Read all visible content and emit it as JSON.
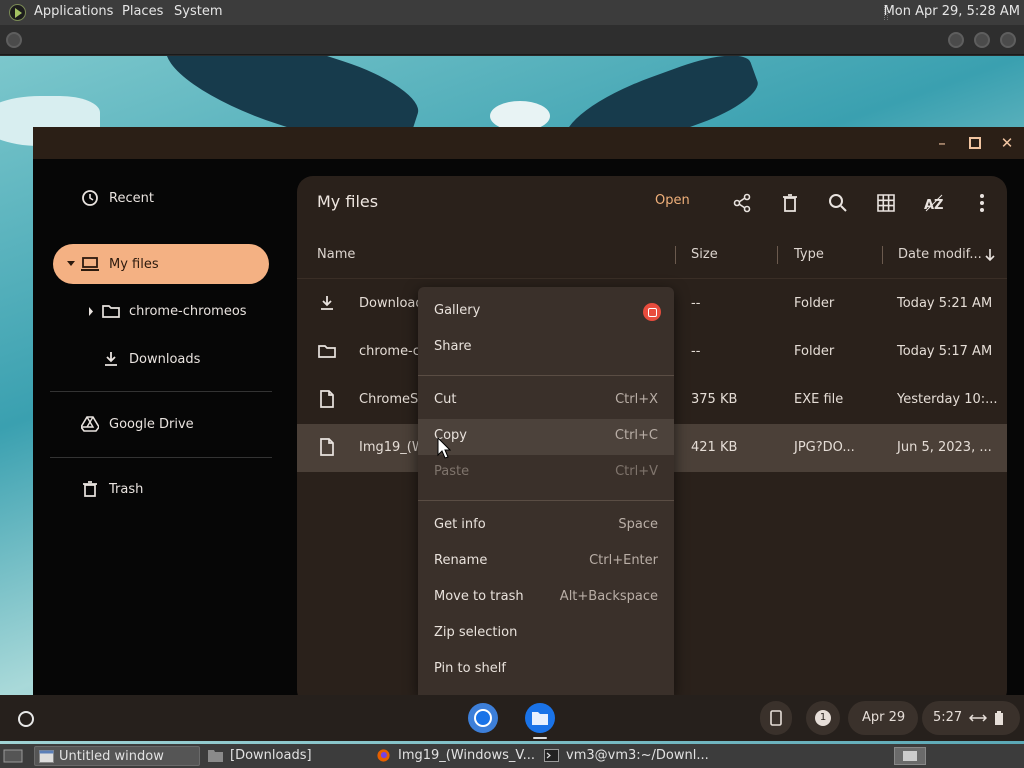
{
  "top_panel": {
    "menus": [
      "Applications",
      "Places",
      "System"
    ],
    "clock": "Mon Apr 29,  5:28 AM"
  },
  "sidebar": {
    "items": [
      {
        "label": "Recent",
        "icon": "clock-icon"
      },
      {
        "label": "My files",
        "icon": "laptop-icon",
        "active": true
      },
      {
        "label": "chrome-chromeos",
        "icon": "folder-icon"
      },
      {
        "label": "Downloads",
        "icon": "download-icon"
      },
      {
        "label": "Google Drive",
        "icon": "drive-icon"
      },
      {
        "label": "Trash",
        "icon": "trash-icon"
      }
    ]
  },
  "main": {
    "title": "My files",
    "open_label": "Open",
    "toolbar_icons": [
      "share-icon",
      "delete-icon",
      "search-icon",
      "grid-view-icon",
      "sort-icon",
      "more-icon"
    ],
    "columns": {
      "name": "Name",
      "size": "Size",
      "type": "Type",
      "date": "Date modif..."
    },
    "rows": [
      {
        "name": "Downloads",
        "size": "--",
        "type": "Folder",
        "date": "Today 5:21 AM",
        "icon": "download-icon"
      },
      {
        "name": "chrome-ch",
        "size": "--",
        "type": "Folder",
        "date": "Today 5:17 AM",
        "icon": "folder-icon"
      },
      {
        "name": "ChromeSe",
        "size": "375 KB",
        "type": "EXE file",
        "date": "Yesterday 10:...",
        "icon": "file-icon"
      },
      {
        "name": "Img19_(W",
        "size": "421 KB",
        "type": "JPG?DO...",
        "date": "Jun 5, 2023, ...",
        "icon": "file-icon",
        "selected": true
      }
    ]
  },
  "context_menu": {
    "items": [
      {
        "label": "Gallery",
        "shortcut": ""
      },
      {
        "label": "Share",
        "shortcut": ""
      },
      {
        "label": "Cut",
        "shortcut": "Ctrl+X"
      },
      {
        "label": "Copy",
        "shortcut": "Ctrl+C"
      },
      {
        "label": "Paste",
        "shortcut": "Ctrl+V",
        "disabled": true
      },
      {
        "label": "Get info",
        "shortcut": "Space"
      },
      {
        "label": "Rename",
        "shortcut": "Ctrl+Enter"
      },
      {
        "label": "Move to trash",
        "shortcut": "Alt+Backspace"
      },
      {
        "label": "Zip selection",
        "shortcut": ""
      },
      {
        "label": "Pin to shelf",
        "shortcut": ""
      }
    ]
  },
  "shelf": {
    "notification_count": "1",
    "date": "Apr 29",
    "time": "5:27"
  },
  "taskbar": {
    "tasks": [
      {
        "label": "Untitled window"
      },
      {
        "label": "[Downloads]"
      },
      {
        "label": "Img19_(Windows_V..."
      },
      {
        "label": "vm3@vm3:~/Downl..."
      }
    ]
  },
  "colors": {
    "accent": "#f4b183",
    "window_bg": "#060606",
    "card_bg": "#2a211b",
    "menu_bg": "#3a302a"
  }
}
